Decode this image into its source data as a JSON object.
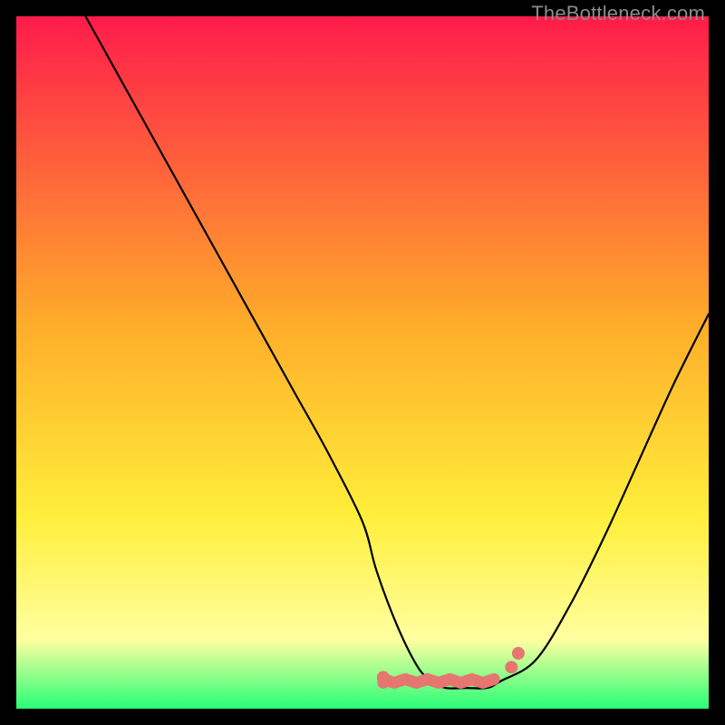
{
  "watermark": "TheBottleneck.com",
  "colors": {
    "gradient_top": "#ff1b4b",
    "gradient_mid1": "#ffae2a",
    "gradient_mid2": "#ffee3a",
    "gradient_mid3": "#ffffa0",
    "gradient_bottom": "#28ff78",
    "curve": "#000000",
    "marker": "#e77570",
    "frame_bg": "#000000"
  },
  "chart_data": {
    "type": "line",
    "title": "",
    "xlabel": "",
    "ylabel": "",
    "xlim": [
      0,
      100
    ],
    "ylim": [
      0,
      100
    ],
    "grid": false,
    "series": [
      {
        "name": "bottleneck-curve",
        "x": [
          10,
          15,
          20,
          25,
          30,
          35,
          40,
          45,
          50,
          52,
          55,
          58,
          60,
          62,
          65,
          68,
          70,
          75,
          80,
          85,
          90,
          95,
          100
        ],
        "y": [
          100,
          91,
          82,
          73,
          64,
          55,
          46,
          37,
          27,
          20,
          12,
          6,
          4,
          3,
          3,
          3,
          4,
          7,
          15,
          25,
          36,
          47,
          57
        ]
      }
    ],
    "annotations": [
      {
        "name": "optimal-band-markers",
        "x_range": [
          53,
          70
        ],
        "y": 4
      }
    ]
  }
}
